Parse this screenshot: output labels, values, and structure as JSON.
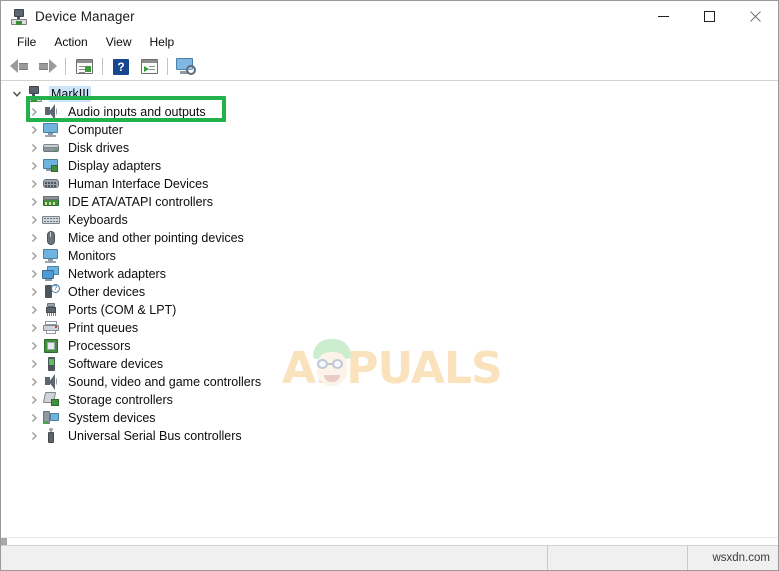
{
  "window": {
    "title": "Device Manager",
    "icon": "device-manager-icon",
    "controls": {
      "minimize": "minimize",
      "maximize": "maximize",
      "close": "close"
    }
  },
  "menubar": {
    "items": [
      {
        "label": "File"
      },
      {
        "label": "Action"
      },
      {
        "label": "View"
      },
      {
        "label": "Help"
      }
    ]
  },
  "toolbar": {
    "items": [
      {
        "name": "back-arrow-icon",
        "tooltip": "Back"
      },
      {
        "name": "forward-arrow-icon",
        "tooltip": "Forward"
      },
      {
        "name": "separator-1"
      },
      {
        "name": "properties-icon",
        "tooltip": "Properties"
      },
      {
        "name": "separator-2"
      },
      {
        "name": "help-icon",
        "tooltip": "Help",
        "glyph": "?"
      },
      {
        "name": "update-driver-icon",
        "tooltip": "Update driver"
      },
      {
        "name": "separator-3"
      },
      {
        "name": "scan-hardware-changes-icon",
        "tooltip": "Scan for hardware changes"
      }
    ]
  },
  "tree": {
    "root": {
      "label": "MarkIII",
      "icon": "computer-icon",
      "expanded": true,
      "selected": true
    },
    "nodes": [
      {
        "label": "Audio inputs and outputs",
        "icon": "speaker-icon",
        "highlighted": true
      },
      {
        "label": "Computer",
        "icon": "computer-monitor-icon",
        "highlighted": false
      },
      {
        "label": "Disk drives",
        "icon": "disk-drive-icon",
        "highlighted": false
      },
      {
        "label": "Display adapters",
        "icon": "display-adapter-icon",
        "highlighted": false
      },
      {
        "label": "Human Interface Devices",
        "icon": "hid-icon",
        "highlighted": false
      },
      {
        "label": "IDE ATA/ATAPI controllers",
        "icon": "ide-controller-icon",
        "highlighted": false
      },
      {
        "label": "Keyboards",
        "icon": "keyboard-icon",
        "highlighted": false
      },
      {
        "label": "Mice and other pointing devices",
        "icon": "mouse-icon",
        "highlighted": false
      },
      {
        "label": "Monitors",
        "icon": "monitor-icon",
        "highlighted": false
      },
      {
        "label": "Network adapters",
        "icon": "network-adapter-icon",
        "highlighted": false
      },
      {
        "label": "Other devices",
        "icon": "unknown-device-icon",
        "highlighted": false
      },
      {
        "label": "Ports (COM & LPT)",
        "icon": "port-icon",
        "highlighted": false
      },
      {
        "label": "Print queues",
        "icon": "printer-icon",
        "highlighted": false
      },
      {
        "label": "Processors",
        "icon": "processor-icon",
        "highlighted": false
      },
      {
        "label": "Software devices",
        "icon": "software-device-icon",
        "highlighted": false
      },
      {
        "label": "Sound, video and game controllers",
        "icon": "speaker-icon",
        "highlighted": false
      },
      {
        "label": "Storage controllers",
        "icon": "storage-controller-icon",
        "highlighted": false
      },
      {
        "label": "System devices",
        "icon": "system-device-icon",
        "highlighted": false
      },
      {
        "label": "Universal Serial Bus controllers",
        "icon": "usb-icon",
        "highlighted": false
      }
    ]
  },
  "highlight": {
    "color": "#22b14c",
    "target": "Audio inputs and outputs"
  },
  "watermark": {
    "text": "APPUALS",
    "color": "#f0a028"
  },
  "statusbar": {
    "main": "",
    "mid": "",
    "right": "wsxdn.com"
  }
}
